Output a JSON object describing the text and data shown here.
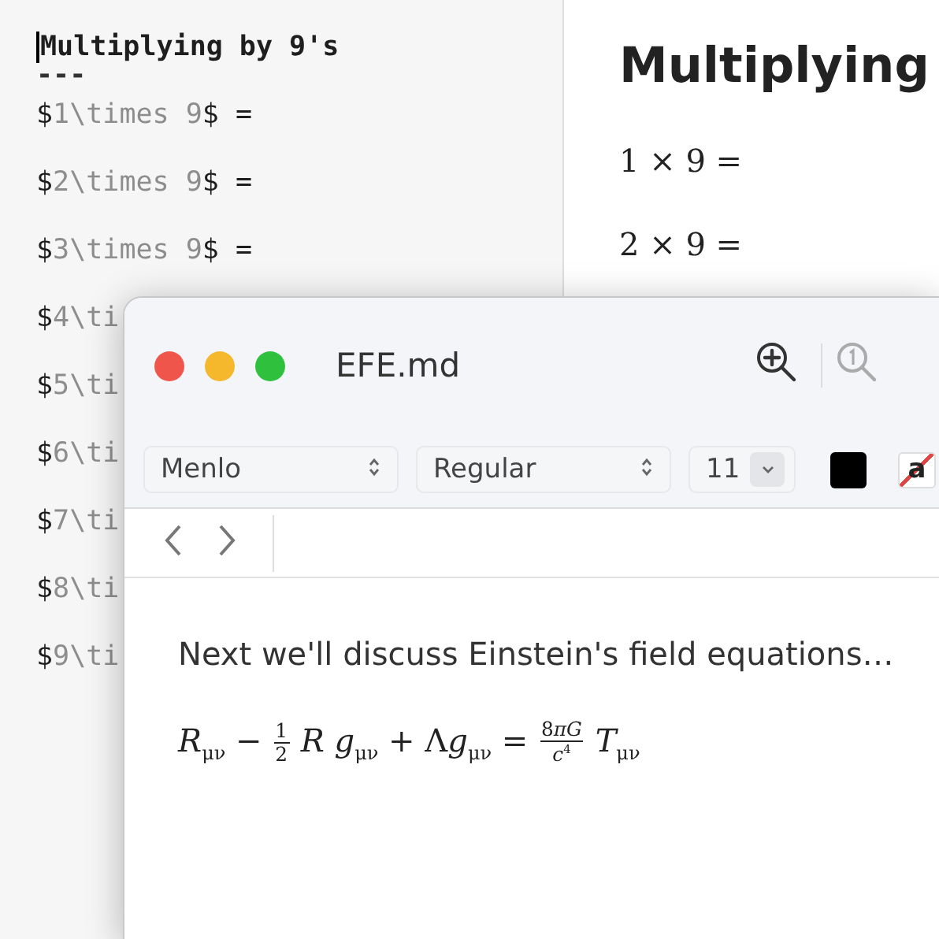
{
  "editor": {
    "title": "Multiplying by 9's",
    "rule": "---",
    "lines": [
      {
        "parts": [
          "$",
          "1\\times 9",
          "$ ="
        ]
      },
      {
        "parts": [
          "$",
          "2\\times 9",
          "$ ="
        ]
      },
      {
        "parts": [
          "$",
          "3\\times 9",
          "$ ="
        ]
      },
      {
        "parts": [
          "$",
          "4\\ti"
        ]
      },
      {
        "parts": [
          "$",
          "5\\ti"
        ]
      },
      {
        "parts": [
          "$",
          "6\\ti"
        ]
      },
      {
        "parts": [
          "$",
          "7\\ti"
        ]
      },
      {
        "parts": [
          "$",
          "8\\ti"
        ]
      },
      {
        "parts": [
          "$",
          "9\\ti"
        ]
      }
    ]
  },
  "preview": {
    "heading": "Multiplying",
    "lines": [
      "1 × 9 =",
      "2 × 9 ="
    ]
  },
  "window": {
    "title": "EFE.md",
    "toolbar": {
      "font_family": "Menlo",
      "font_style": "Regular",
      "font_size": "11",
      "text_color_label": "a"
    },
    "paragraph": "Next we'll discuss Einstein's field equations…",
    "equation": [
      {
        "kind": "text",
        "text": "*R*$_{μν}$ − "
      },
      {
        "kind": "frac",
        "num": [
          "1"
        ],
        "den": [
          "2"
        ]
      },
      {
        "kind": "text",
        "text": " *R g*$_{μν}$ + Λ"
      },
      {
        "kind": "text",
        "text": "*g*$_{μν}$ = "
      },
      {
        "kind": "frac",
        "num": [
          "8",
          "*πG*"
        ],
        "den": [
          "*c*$^{4}$"
        ]
      },
      {
        "kind": "text",
        "text": " *T*$_{μν}$"
      }
    ]
  }
}
